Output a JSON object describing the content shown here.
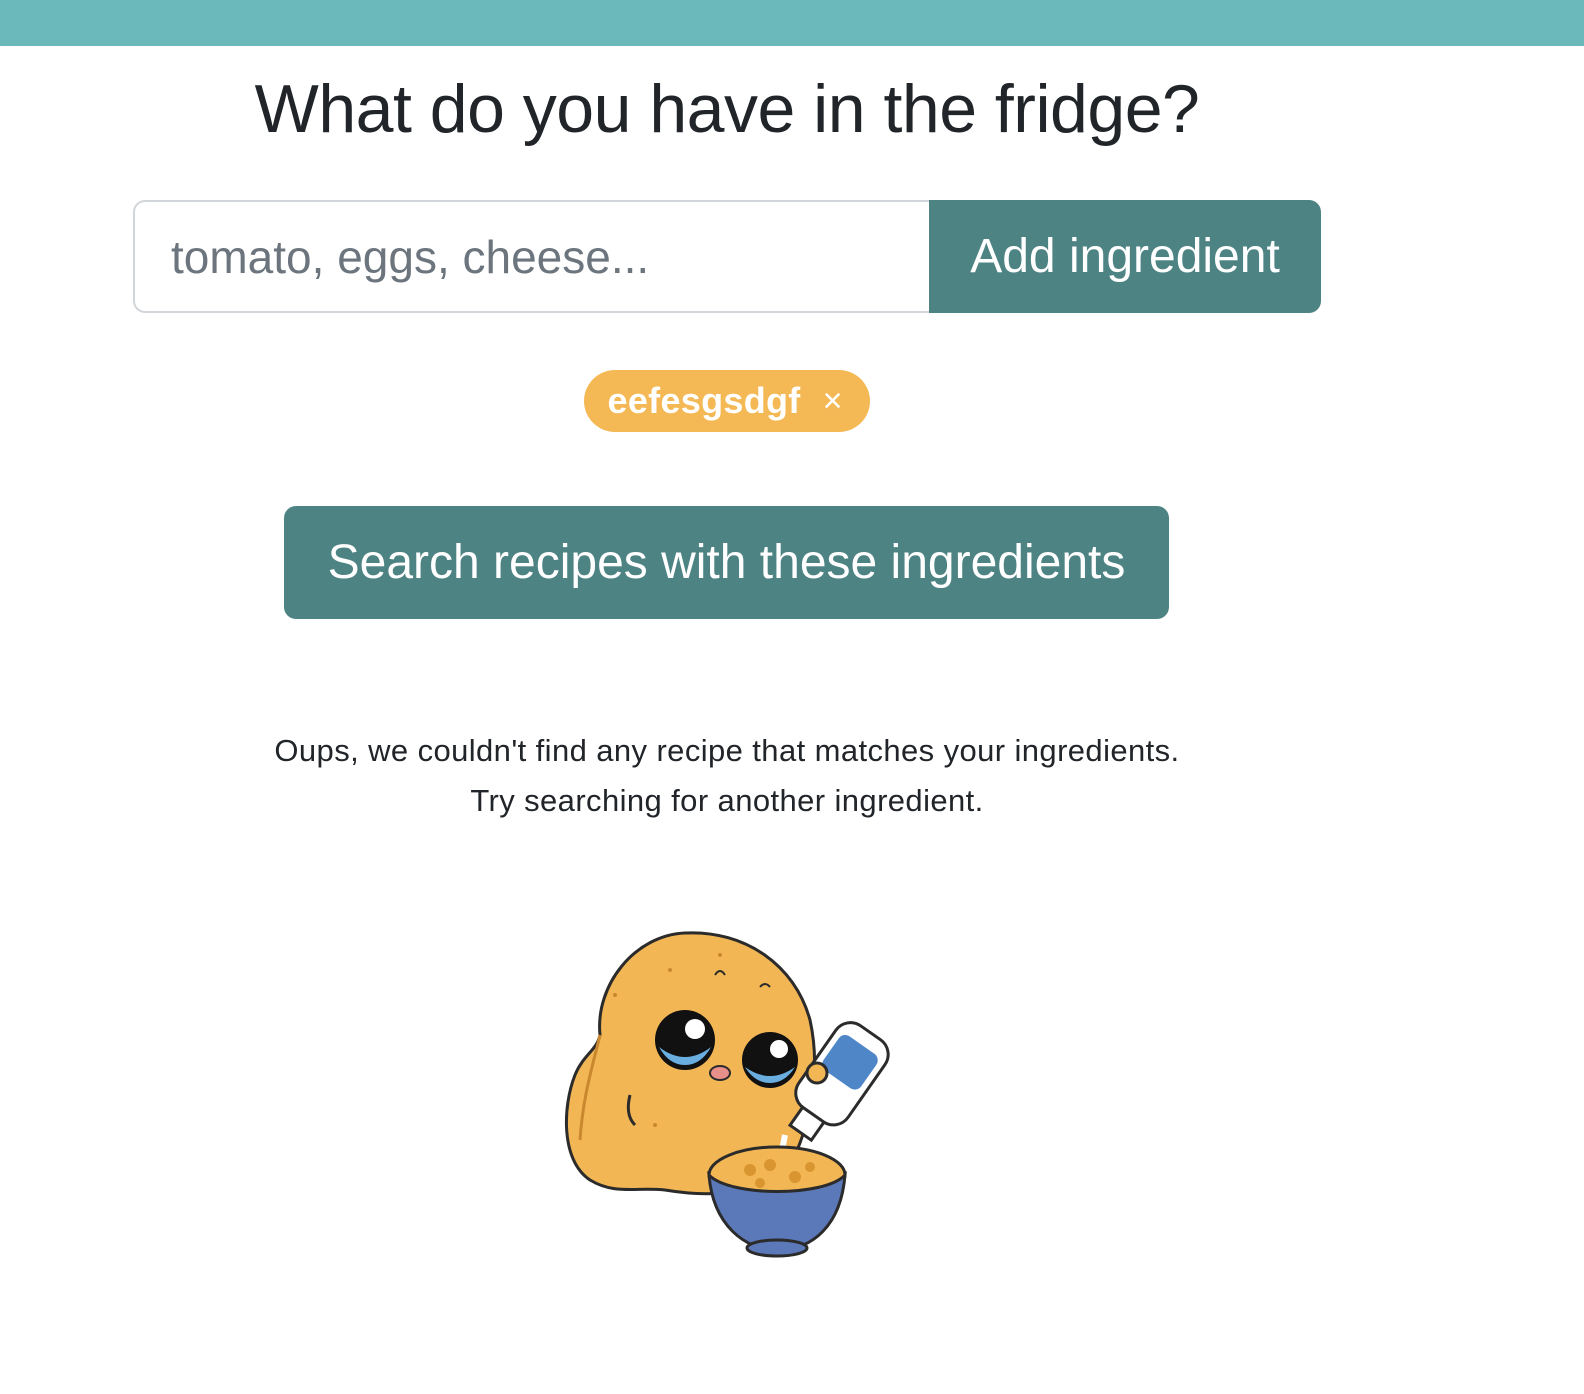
{
  "header": {
    "accent_color": "#6cb9bc"
  },
  "main": {
    "title": "What do you have in the fridge?",
    "ingredient_input": {
      "placeholder": "tomato, eggs, cheese...",
      "value": ""
    },
    "add_button_label": "Add ingredient",
    "chips": [
      {
        "label": "eefesgsdgf",
        "remove_icon": "close-icon",
        "remove_glyph": "×"
      }
    ],
    "search_button_label": "Search recipes with these ingredients",
    "empty_state": {
      "line1": "Oups, we couldn't find any recipe that matches your ingredients.",
      "line2": "Try searching for another ingredient."
    }
  },
  "colors": {
    "primary": "#4e8384",
    "chip": "#f4b955",
    "topbar": "#6cb9bc"
  }
}
